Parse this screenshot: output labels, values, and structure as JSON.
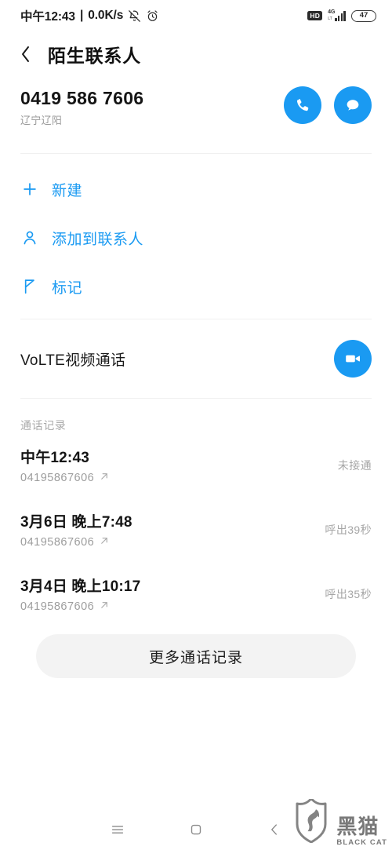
{
  "status_bar": {
    "time": "中午12:43",
    "separator": "|",
    "network_speed": "0.0K/s",
    "mute_icon": "bell-muted-icon",
    "alarm_icon": "alarm-clock-icon",
    "hd_badge": "HD",
    "network_type": "4G",
    "network_sub": "LT",
    "battery_level": "47"
  },
  "header": {
    "back_icon": "chevron-left-icon",
    "title": "陌生联系人"
  },
  "contact": {
    "number": "0419 586 7606",
    "location": "辽宁辽阳",
    "call_button_icon": "phone-icon",
    "message_button_icon": "message-bubble-icon",
    "accent_color": "#1a9af2"
  },
  "quick_actions": [
    {
      "icon": "plus-icon",
      "label": "新建"
    },
    {
      "icon": "person-icon",
      "label": "添加到联系人"
    },
    {
      "icon": "flag-icon",
      "label": "标记"
    }
  ],
  "volte": {
    "label": "VoLTE视频通话",
    "button_icon": "video-camera-icon"
  },
  "call_log": {
    "section_title": "通话记录",
    "entries": [
      {
        "when": "中午12:43",
        "number": "04195867606",
        "direction_icon": "arrow-outgoing-icon",
        "status": "未接通"
      },
      {
        "when": "3月6日 晚上7:48",
        "number": "04195867606",
        "direction_icon": "arrow-outgoing-icon",
        "status": "呼出39秒"
      },
      {
        "when": "3月4日 晚上10:17",
        "number": "04195867606",
        "direction_icon": "arrow-outgoing-icon",
        "status": "呼出35秒"
      }
    ],
    "more_button": "更多通话记录"
  },
  "nav_bar": {
    "recents_icon": "menu-lines-icon",
    "home_icon": "square-home-icon",
    "back_icon": "chevron-left-icon"
  },
  "watermark": {
    "shield_icon": "black-cat-shield-icon",
    "cn_text": "黑猫",
    "en_text": "BLACK CAT"
  }
}
